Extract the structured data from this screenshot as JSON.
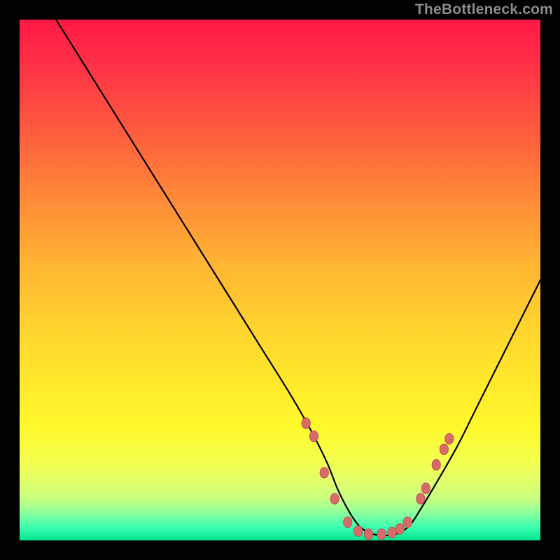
{
  "watermark": {
    "text": "TheBottleneck.com"
  },
  "colors": {
    "background": "#000000",
    "curve": "#000000",
    "dot_fill": "#d86a6a",
    "dot_stroke": "#b84e4e"
  },
  "chart_data": {
    "type": "line",
    "title": "",
    "xlabel": "",
    "ylabel": "",
    "xlim": [
      0,
      100
    ],
    "ylim": [
      0,
      100
    ],
    "grid": false,
    "legend": false,
    "series": [
      {
        "name": "bottleneck-curve",
        "x": [
          7,
          12,
          17,
          22,
          27,
          32,
          37,
          42,
          47,
          52,
          56,
          59,
          61,
          63,
          65,
          67,
          69,
          71,
          73,
          75,
          77,
          80,
          84,
          88,
          92,
          96,
          100
        ],
        "y": [
          100,
          92,
          84,
          76,
          68,
          60,
          52,
          44,
          36,
          28,
          21,
          15,
          10,
          6,
          3,
          1.5,
          1,
          1,
          1.5,
          3,
          6,
          11,
          18,
          26,
          34,
          42,
          50
        ]
      }
    ],
    "markers": [
      {
        "x": 55.0,
        "y": 22.5
      },
      {
        "x": 56.5,
        "y": 20.0
      },
      {
        "x": 58.5,
        "y": 13.0
      },
      {
        "x": 60.5,
        "y": 8.0
      },
      {
        "x": 63.0,
        "y": 3.5
      },
      {
        "x": 65.0,
        "y": 1.8
      },
      {
        "x": 67.0,
        "y": 1.2
      },
      {
        "x": 69.5,
        "y": 1.2
      },
      {
        "x": 71.5,
        "y": 1.5
      },
      {
        "x": 73.0,
        "y": 2.2
      },
      {
        "x": 74.5,
        "y": 3.5
      },
      {
        "x": 77.0,
        "y": 8.0
      },
      {
        "x": 78.0,
        "y": 10.0
      },
      {
        "x": 80.0,
        "y": 14.5
      },
      {
        "x": 81.5,
        "y": 17.5
      },
      {
        "x": 82.5,
        "y": 19.5
      }
    ]
  }
}
